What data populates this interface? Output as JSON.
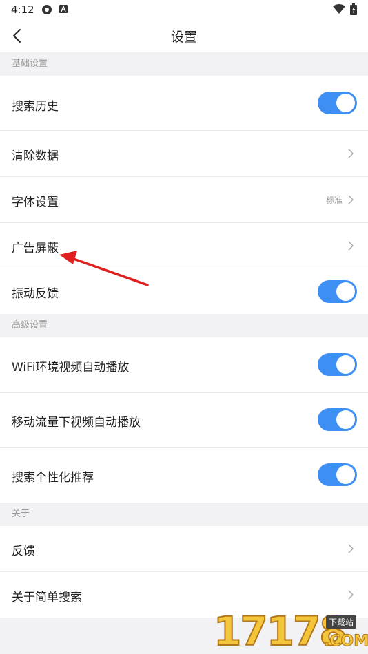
{
  "status_bar": {
    "time": "4:12",
    "icons": [
      "gear-notification-icon",
      "a-notification-icon",
      "wifi-icon",
      "battery-charging-icon"
    ]
  },
  "nav": {
    "title": "设置",
    "back_icon": "chevron-left-icon"
  },
  "sections": {
    "basic": {
      "header": "基础设置",
      "search_history": {
        "label": "搜索历史",
        "toggle_on": true
      },
      "clear_data": {
        "label": "清除数据"
      },
      "font_settings": {
        "label": "字体设置",
        "value": "标准"
      },
      "ad_block": {
        "label": "广告屏蔽"
      },
      "vibration": {
        "label": "振动反馈",
        "toggle_on": true
      }
    },
    "advanced": {
      "header": "高级设置",
      "wifi_autoplay": {
        "label": "WiFi环境视频自动播放",
        "toggle_on": true
      },
      "mobile_autoplay": {
        "label": "移动流量下视频自动播放",
        "toggle_on": true
      },
      "personalized": {
        "label": "搜索个性化推荐",
        "toggle_on": true
      }
    },
    "about": {
      "header": "关于",
      "feedback": {
        "label": "反馈"
      },
      "about_app": {
        "label": "关于简单搜索"
      }
    }
  },
  "colors": {
    "accent": "#3d8ff4",
    "annotation_arrow": "#e02020",
    "background": "#f2f2f4"
  },
  "watermark": {
    "digits": "17178",
    "tag": "下载站",
    "suffix": ".COM"
  }
}
